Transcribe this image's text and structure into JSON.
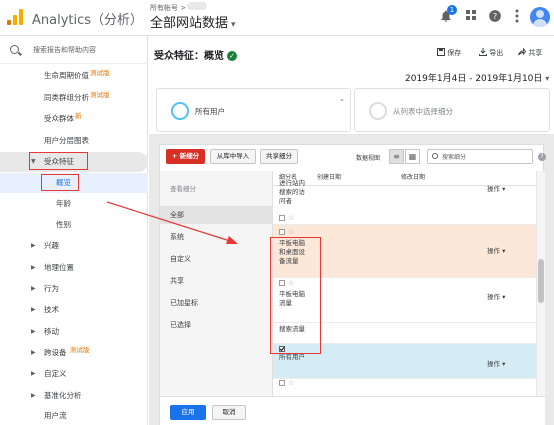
{
  "topbar": {
    "app_title": "Analytics（分析）",
    "account_label": "所有帐号 >",
    "account_name": "全部网站数据",
    "account_caret": "▾",
    "notification_count": "1",
    "icons": [
      "bell-icon",
      "apps-icon",
      "help-icon",
      "more-icon",
      "avatar"
    ]
  },
  "sidebar": {
    "search_placeholder": "搜索报告和帮助内容",
    "items": [
      {
        "label": "生命周期价值",
        "tag": "测试版"
      },
      {
        "label": "同类群组分析",
        "tag": "测试版"
      },
      {
        "label": "受众群体",
        "tag": "新"
      },
      {
        "label": "用户分层图表",
        "tag": ""
      },
      {
        "label": "受众特征",
        "tag": ""
      },
      {
        "label": "概览",
        "tag": ""
      },
      {
        "label": "年龄",
        "tag": ""
      },
      {
        "label": "性别",
        "tag": ""
      },
      {
        "label": "兴趣",
        "tag": ""
      },
      {
        "label": "地理位置",
        "tag": ""
      },
      {
        "label": "行为",
        "tag": ""
      },
      {
        "label": "技术",
        "tag": ""
      },
      {
        "label": "移动",
        "tag": ""
      },
      {
        "label": "跨设备",
        "tag": "测试版"
      },
      {
        "label": "自定义",
        "tag": ""
      },
      {
        "label": "基准化分析",
        "tag": ""
      },
      {
        "label": "用户流",
        "tag": ""
      }
    ]
  },
  "header": {
    "page_title": "受众特征：概览",
    "verified_mark": "✓",
    "save_label": "保存",
    "export_label": "导出",
    "share_label": "共享",
    "date_range": "2019年1月4日 - 2019年1月10日",
    "date_caret": "▾"
  },
  "segments": {
    "card1_label": "所有用户",
    "card2_label": "从列表中选择细分",
    "card_caret": "⌄"
  },
  "picker": {
    "new_segment": "+ 新细分",
    "import_from_gallery": "从库中导入",
    "share_segment": "共享细分",
    "view_label": "数据视图",
    "search_placeholder": "搜索细分",
    "help": "?",
    "category_header": "查看细分",
    "categories": [
      "全部",
      "系统",
      "自定义",
      "共享",
      "已加星标",
      "已选择"
    ],
    "columns": {
      "name": "细分名",
      "created": "创建日期",
      "modified": "修改日期"
    },
    "rows": [
      {
        "name": "进行站内搜索的访问者",
        "ops": "操作 ▾"
      },
      {
        "name": "平板电脑和桌面设备流量",
        "ops": "操作 ▾"
      },
      {
        "name": "平板电脑流量",
        "ops": "操作 ▾"
      },
      {
        "name": "搜索流量",
        "ops": ""
      },
      {
        "name": "所有用户",
        "ops": "操作 ▾"
      },
      {
        "name": "",
        "ops": ""
      }
    ],
    "apply": "应用",
    "cancel": "取消"
  },
  "colors": {
    "accent_blue": "#1a73e8",
    "new_segment_red": "#d93025",
    "annotation_red": "#e53935",
    "selected_row_blue": "#d6ecf5",
    "highlight_row_peach": "#fce8d8",
    "beta_tag_orange": "#e37400"
  }
}
